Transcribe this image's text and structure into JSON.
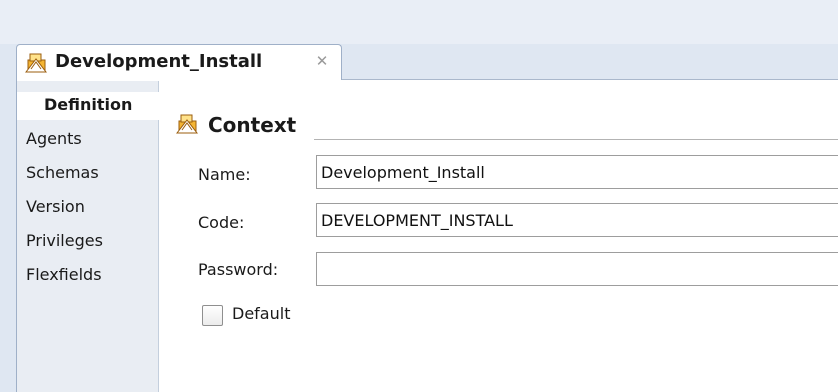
{
  "tab": {
    "title": "Development_Install",
    "close_icon": "close-icon",
    "icon": "context-icon"
  },
  "sidebar": {
    "items": [
      {
        "label": "Definition",
        "active": true
      },
      {
        "label": "Agents"
      },
      {
        "label": "Schemas"
      },
      {
        "label": "Version"
      },
      {
        "label": "Privileges"
      },
      {
        "label": "Flexfields"
      }
    ]
  },
  "section": {
    "title": "Context",
    "icon": "context-icon"
  },
  "form": {
    "name_label": "Name:",
    "name_value": "Development_Install",
    "code_label": "Code:",
    "code_value": "DEVELOPMENT_INSTALL",
    "password_label": "Password:",
    "password_value": "",
    "default_label": "Default",
    "default_checked": false
  },
  "colors": {
    "tab_bar": "#dfe7f2",
    "sidebar": "#e9edf3",
    "icon_orange": "#f0a020"
  }
}
